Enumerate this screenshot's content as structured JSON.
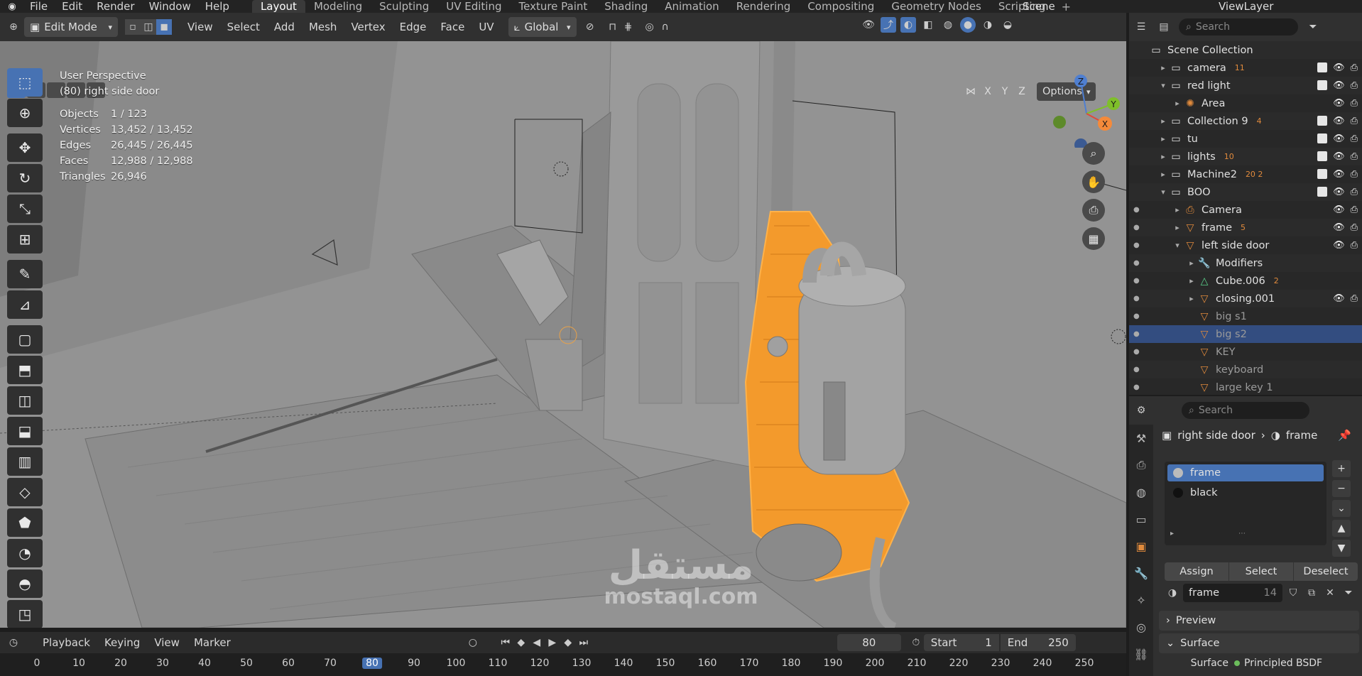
{
  "topbar": {
    "menus": [
      "File",
      "Edit",
      "Render",
      "Window",
      "Help"
    ],
    "workspaces": [
      "Layout",
      "Modeling",
      "Sculpting",
      "UV Editing",
      "Texture Paint",
      "Shading",
      "Animation",
      "Rendering",
      "Compositing",
      "Geometry Nodes",
      "Scripting"
    ],
    "active_workspace": "Layout",
    "scene": "Scene",
    "view_layer": "ViewLayer"
  },
  "viewport_header": {
    "mode": "Edit Mode",
    "menus": [
      "View",
      "Select",
      "Add",
      "Mesh",
      "Vertex",
      "Edge",
      "Face",
      "UV"
    ],
    "orientation": "Global",
    "options": "Options",
    "axes": [
      "X",
      "Y",
      "Z"
    ]
  },
  "overlay": {
    "perspective": "User Perspective",
    "object": "(80) right side door",
    "stats": [
      {
        "label": "Objects",
        "value": "1 / 123"
      },
      {
        "label": "Vertices",
        "value": "13,452 / 13,452"
      },
      {
        "label": "Edges",
        "value": "26,445 / 26,445"
      },
      {
        "label": "Faces",
        "value": "12,988 / 12,988"
      },
      {
        "label": "Triangles",
        "value": "26,946"
      }
    ]
  },
  "gizmo": {
    "z": "Z",
    "y": "Y",
    "x": "X"
  },
  "watermark": {
    "arabic": "مستقل",
    "latin": "mostaql.com"
  },
  "timeline": {
    "menus": [
      "Playback",
      "Keying",
      "View",
      "Marker"
    ],
    "current_frame": "80",
    "start_label": "Start",
    "start": "1",
    "end_label": "End",
    "end": "250",
    "ticks": [
      "0",
      "10",
      "20",
      "30",
      "40",
      "50",
      "60",
      "70",
      "80",
      "90",
      "100",
      "110",
      "120",
      "130",
      "140",
      "150",
      "160",
      "170",
      "180",
      "190",
      "200",
      "210",
      "220",
      "230",
      "240",
      "250"
    ]
  },
  "outliner": {
    "search_placeholder": "Search",
    "root": "Scene Collection",
    "rows": [
      {
        "label": "camera",
        "icon": "collection-icon",
        "arrow": "▸",
        "badge": "11"
      },
      {
        "label": "red light",
        "icon": "collection-icon",
        "arrow": "▾",
        "badge": ""
      },
      {
        "label": "Area",
        "icon": "light-icon",
        "arrow": "▸",
        "badge": ""
      },
      {
        "label": "Collection 9",
        "icon": "collection-icon",
        "arrow": "▸",
        "badge": "4"
      },
      {
        "label": "tu",
        "icon": "collection-icon",
        "arrow": "▸",
        "badge": ""
      },
      {
        "label": "lights",
        "icon": "collection-icon",
        "arrow": "▸",
        "badge": "10"
      },
      {
        "label": "Machine2",
        "icon": "collection-icon",
        "arrow": "▸",
        "badge": "20 2"
      },
      {
        "label": "BOO",
        "icon": "collection-icon",
        "arrow": "▾",
        "badge": ""
      },
      {
        "label": "Camera",
        "icon": "camera-icon",
        "arrow": "▸",
        "badge": ""
      },
      {
        "label": "frame",
        "icon": "mesh-icon",
        "arrow": "▸",
        "badge": "5"
      },
      {
        "label": "left side door",
        "icon": "mesh-icon",
        "arrow": "▾",
        "badge": ""
      },
      {
        "label": "Modifiers",
        "icon": "wrench-icon",
        "arrow": "▸",
        "badge": ""
      },
      {
        "label": "Cube.006",
        "icon": "mesh-data-icon",
        "arrow": "▸",
        "badge": "2"
      },
      {
        "label": "closing.001",
        "icon": "mesh-icon",
        "arrow": "▸",
        "badge": ""
      },
      {
        "label": "big s1",
        "icon": "mesh-icon",
        "arrow": "",
        "badge": ""
      },
      {
        "label": "big s2",
        "icon": "mesh-icon",
        "arrow": "",
        "badge": ""
      },
      {
        "label": "KEY",
        "icon": "mesh-icon",
        "arrow": "",
        "badge": ""
      },
      {
        "label": "keyboard",
        "icon": "mesh-icon",
        "arrow": "",
        "badge": ""
      },
      {
        "label": "large key 1",
        "icon": "mesh-icon",
        "arrow": "",
        "badge": ""
      }
    ],
    "selected_row": "big s2"
  },
  "properties": {
    "search_placeholder": "Search",
    "breadcrumb_object": "right side door",
    "breadcrumb_material": "frame",
    "materials": [
      "frame",
      "black"
    ],
    "selected_material": "frame",
    "buttons": [
      "Assign",
      "Select",
      "Deselect"
    ],
    "material_field": "frame",
    "material_users": "14",
    "panels": {
      "preview": "Preview",
      "surface": "Surface"
    },
    "surface_label": "Surface",
    "surface_value": "Principled BSDF"
  },
  "colors": {
    "accent": "#4772b3",
    "selection_orange": "#ff9a1f",
    "viewport_bg": "#8e8e8e"
  }
}
